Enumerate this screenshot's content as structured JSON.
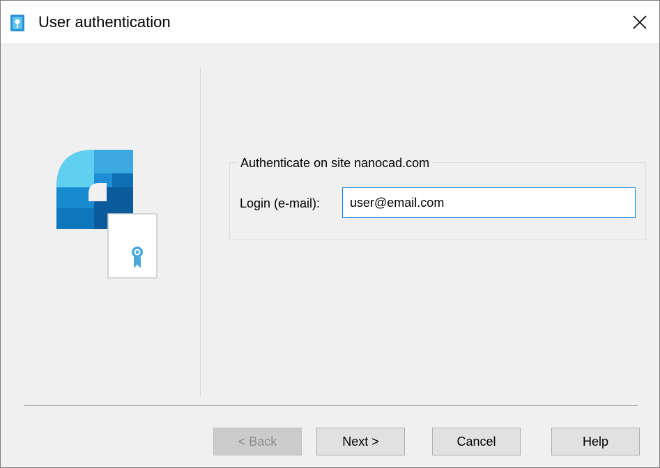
{
  "window": {
    "title": "User authentication",
    "close_glyph": "✕",
    "title_icon": "key-certificate-icon",
    "close_icon": "close-icon"
  },
  "auth_group": {
    "legend": "Authenticate on site nanocad.com",
    "login_label": "Login (e-mail):",
    "login_value": "user@email.com"
  },
  "footer": {
    "back_label": "< Back",
    "next_label": "Next >",
    "cancel_label": "Cancel",
    "help_label": "Help",
    "back_enabled": false
  },
  "logo": {
    "icon": "nanocad-certificate-logo-icon",
    "colors": {
      "dark_blue": "#0a5a9c",
      "mid_blue": "#1e8fd6",
      "light_cyan": "#5fd0f0",
      "ribbon": "#4aa8d8"
    }
  },
  "colors": {
    "background": "#f0f0f0",
    "titlebar": "#ffffff",
    "input_focus_border": "#1e84d7"
  }
}
